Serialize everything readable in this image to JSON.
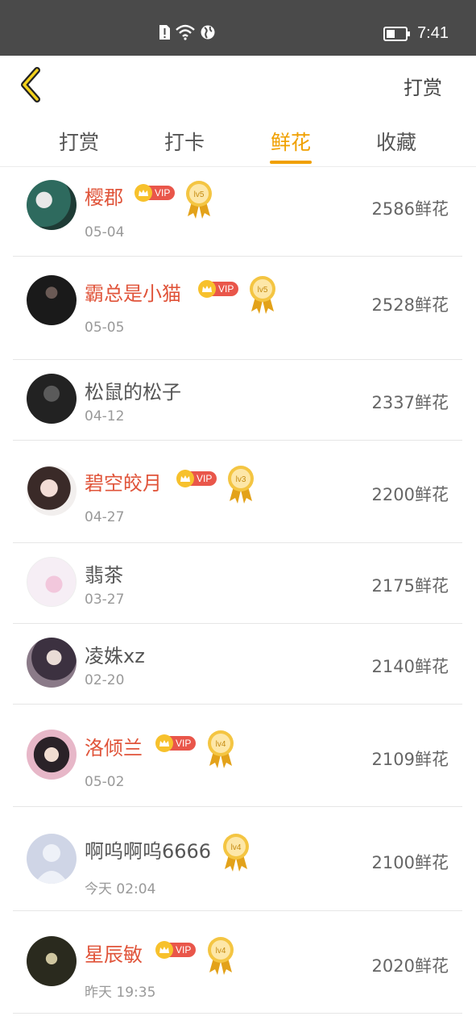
{
  "status_bar": {
    "time": "7:41",
    "icons": [
      "sim-alert-icon",
      "wifi-icon",
      "globe-icon",
      "battery-icon"
    ]
  },
  "nav": {
    "back_icon": "chevron-left-icon",
    "reward_label": "打赏"
  },
  "tabs": [
    {
      "label": "打赏",
      "active": false
    },
    {
      "label": "打卡",
      "active": false
    },
    {
      "label": "鲜花",
      "active": true
    },
    {
      "label": "收藏",
      "active": false
    }
  ],
  "accent_color": "#f0a000",
  "vip_name_color": "#e0543a",
  "list": [
    {
      "name": "樱郡",
      "date": "05-04",
      "count": "2586鲜花",
      "vip": true,
      "vip_label": "VIP",
      "level": "lv5"
    },
    {
      "name": "霸总是小猫",
      "date": "05-05",
      "count": "2528鲜花",
      "vip": true,
      "vip_label": "VIP",
      "level": "lv5"
    },
    {
      "name": "松鼠的松子",
      "date": "04-12",
      "count": "2337鲜花",
      "vip": false
    },
    {
      "name": "碧空皎月",
      "date": "04-27",
      "count": "2200鲜花",
      "vip": true,
      "vip_label": "VIP",
      "level": "lv3"
    },
    {
      "name": "翡茶",
      "date": "03-27",
      "count": "2175鲜花",
      "vip": false
    },
    {
      "name": "凌姝xz",
      "date": "02-20",
      "count": "2140鲜花",
      "vip": false
    },
    {
      "name": "洛倾兰",
      "date": "05-02",
      "count": "2109鲜花",
      "vip": true,
      "vip_label": "VIP",
      "level": "lv4"
    },
    {
      "name": "啊呜啊呜6666",
      "date": "今天 02:04",
      "count": "2100鲜花",
      "vip": false,
      "level": "lv4"
    },
    {
      "name": "星辰敏",
      "date": "昨天 19:35",
      "count": "2020鲜花",
      "vip": true,
      "vip_label": "VIP",
      "level": "lv4"
    }
  ]
}
